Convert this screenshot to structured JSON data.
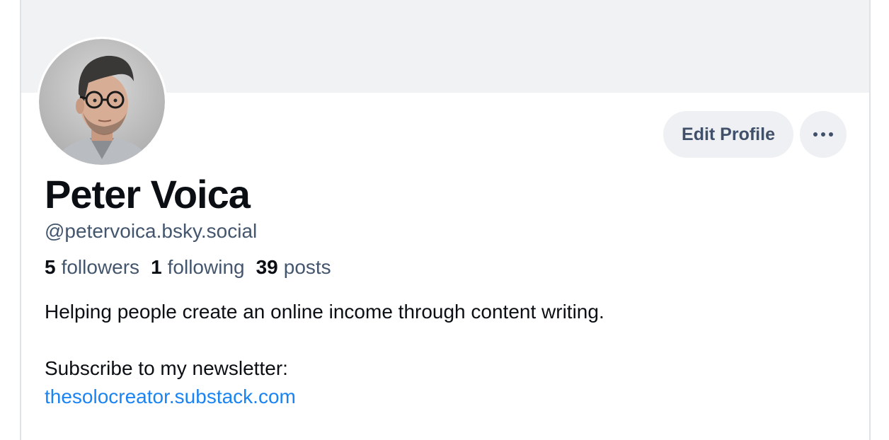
{
  "profile": {
    "display_name": "Peter Voica",
    "handle": "@petervoica.bsky.social",
    "avatar_icon": "avatar-photo",
    "stats": {
      "followers_count": "5",
      "followers_label": "followers",
      "following_count": "1",
      "following_label": "following",
      "posts_count": "39",
      "posts_label": "posts"
    },
    "bio": {
      "line1": "Helping people create an online income through content writing.",
      "line2": "Subscribe to my newsletter:",
      "link": "thesolocreator.substack.com"
    }
  },
  "actions": {
    "edit_label": "Edit Profile",
    "more_icon": "ellipsis-icon"
  },
  "colors": {
    "banner": "#f1f2f4",
    "link": "#1a84f2",
    "muted": "#44566e",
    "button_bg": "#eef0f3"
  }
}
